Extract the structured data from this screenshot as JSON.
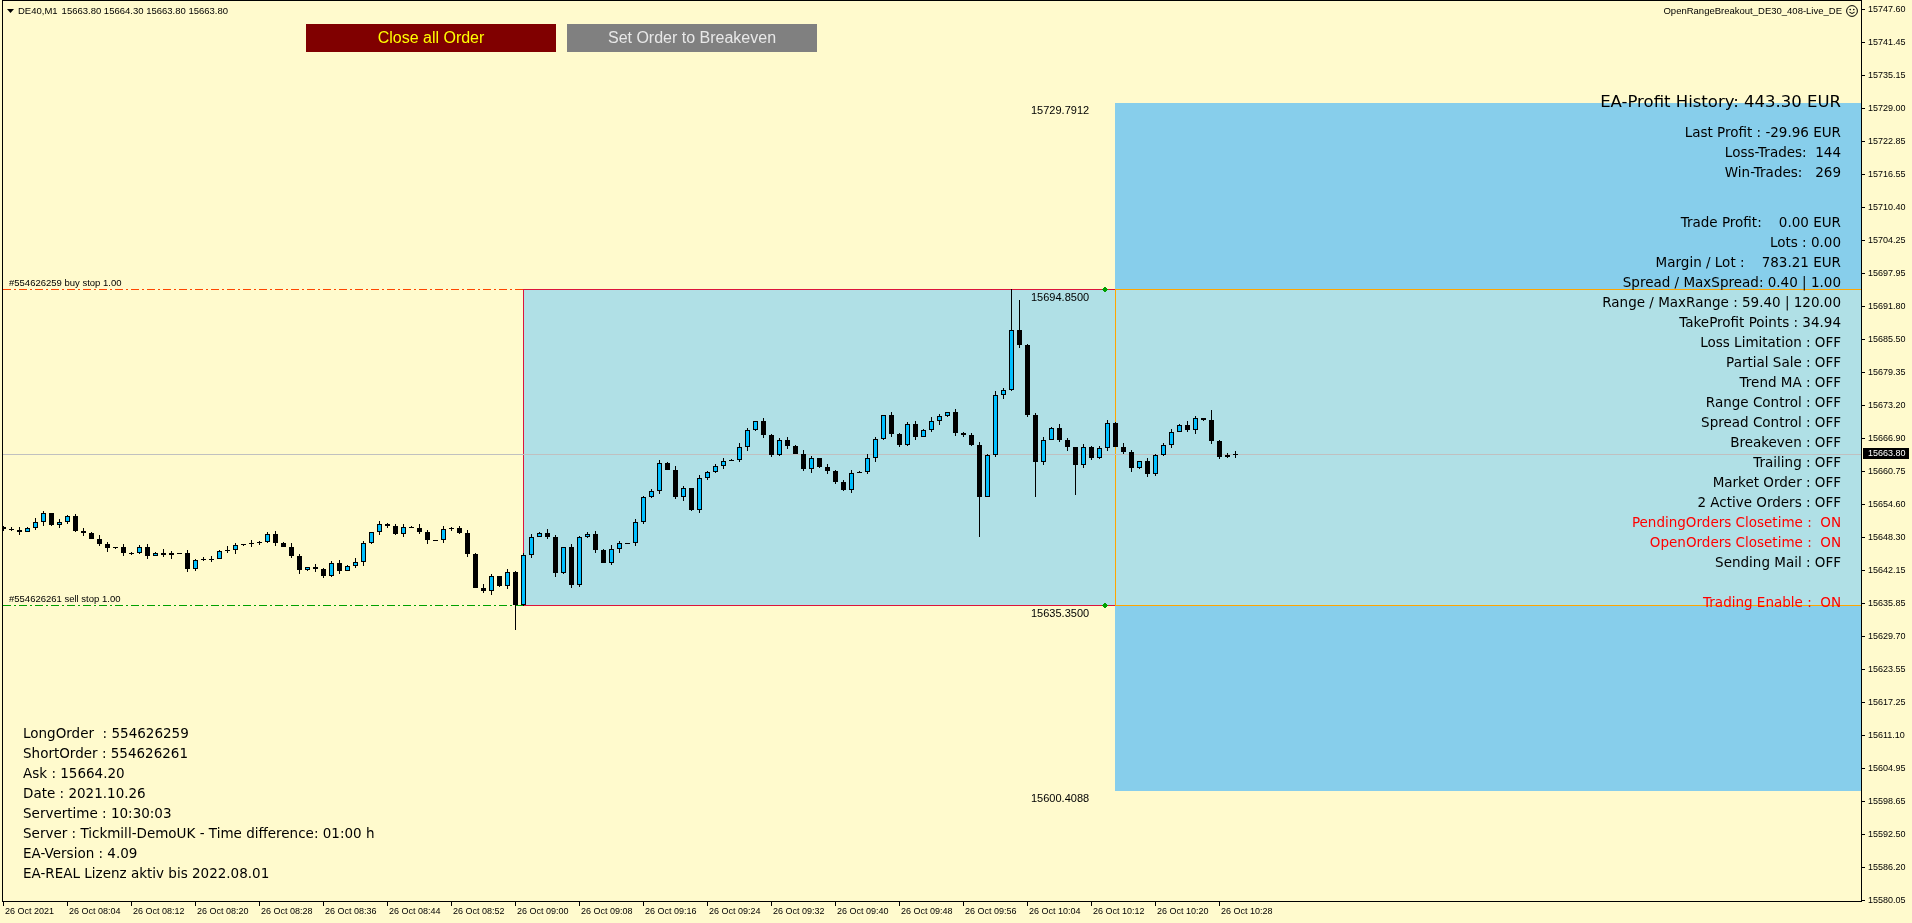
{
  "chart_header": {
    "symbol": "DE40,M1",
    "ohlc": "15663.80 15664.30 15663.80 15663.80",
    "expert_name": "OpenRangeBreakout_DE30_408-Live_DE"
  },
  "buttons": [
    {
      "label": "Close all Order",
      "kind": "danger"
    },
    {
      "label": "Set Order to Breakeven",
      "kind": "neutral"
    }
  ],
  "level_labels": [
    "15729.7912",
    "15694.8500",
    "15635.3500",
    "15600.4088"
  ],
  "order_lines": [
    {
      "label": "#554626259 buy stop 1.00",
      "kind": "buy"
    },
    {
      "label": "#554626261 sell stop 1.00",
      "kind": "sell"
    }
  ],
  "profit_panel": {
    "title": "EA-Profit History: 443.30 EUR",
    "sections": [
      [
        {
          "text": "Last Profit : -29.96 EUR",
          "color": "#000000"
        },
        {
          "text": "Loss-Trades:  144",
          "color": "#000000"
        },
        {
          "text": "Win-Trades:   269",
          "color": "#000000"
        }
      ],
      [
        {
          "text": "Trade Profit:    0.00 EUR",
          "color": "#000000"
        },
        {
          "text": "Lots : 0.00",
          "color": "#000000"
        },
        {
          "text": "Margin / Lot :    783.21 EUR",
          "color": "#000000"
        },
        {
          "text": "Spread / MaxSpread: 0.40 | 1.00",
          "color": "#000000"
        },
        {
          "text": "Range / MaxRange : 59.40 | 120.00",
          "color": "#000000"
        },
        {
          "text": "TakeProfit Points : 34.94",
          "color": "#000000"
        },
        {
          "text": "Loss Limitation : OFF",
          "color": "#000000"
        },
        {
          "text": "Partial Sale : OFF",
          "color": "#000000"
        },
        {
          "text": "Trend MA : OFF",
          "color": "#000000"
        },
        {
          "text": "Range Control : OFF",
          "color": "#000000"
        },
        {
          "text": "Spread Control : OFF",
          "color": "#000000"
        },
        {
          "text": "Breakeven : OFF",
          "color": "#000000"
        },
        {
          "text": "Trailing : OFF",
          "color": "#000000"
        },
        {
          "text": "Market Order : OFF",
          "color": "#000000"
        },
        {
          "text": "2 Active Orders : OFF",
          "color": "#000000"
        },
        {
          "text": "PendingOrders Closetime :  ON",
          "color": "#ff0000"
        },
        {
          "text": "OpenOrders Closetime :  ON",
          "color": "#ff0000"
        },
        {
          "text": "Sending Mail : OFF",
          "color": "#000000"
        }
      ],
      [
        {
          "text": "Trading Enable :  ON",
          "color": "#ff0000"
        }
      ]
    ]
  },
  "account_info": [
    "LongOrder  : 554626259",
    "ShortOrder : 554626261",
    "Ask : 15664.20",
    "Date : 2021.10.26",
    "Servertime : 10:30:03",
    "Server : Tickmill-DemoUK - Time difference: 01:00 h",
    "EA-Version : 4.09",
    "EA-REAL Lizenz aktiv bis 2022.08.01"
  ],
  "price_axis": {
    "labels": [
      "15747.60",
      "15741.45",
      "15735.15",
      "15729.00",
      "15722.85",
      "15716.55",
      "15710.40",
      "15704.25",
      "15697.95",
      "15691.80",
      "15685.50",
      "15679.35",
      "15673.20",
      "15666.90",
      "15660.75",
      "15654.60",
      "15648.30",
      "15642.15",
      "15635.85",
      "15629.70",
      "15623.55",
      "15617.25",
      "15611.10",
      "15604.95",
      "15598.65",
      "15592.50",
      "15586.20",
      "15580.05"
    ],
    "current_price": "15663.80"
  },
  "time_axis": {
    "labels": [
      "26 Oct 2021",
      "26 Oct 08:04",
      "26 Oct 08:12",
      "26 Oct 08:20",
      "26 Oct 08:28",
      "26 Oct 08:36",
      "26 Oct 08:44",
      "26 Oct 08:52",
      "26 Oct 09:00",
      "26 Oct 09:08",
      "26 Oct 09:16",
      "26 Oct 09:24",
      "26 Oct 09:32",
      "26 Oct 09:40",
      "26 Oct 09:48",
      "26 Oct 09:56",
      "26 Oct 10:04",
      "26 Oct 10:12",
      "26 Oct 10:20",
      "26 Oct 10:28"
    ]
  }
}
